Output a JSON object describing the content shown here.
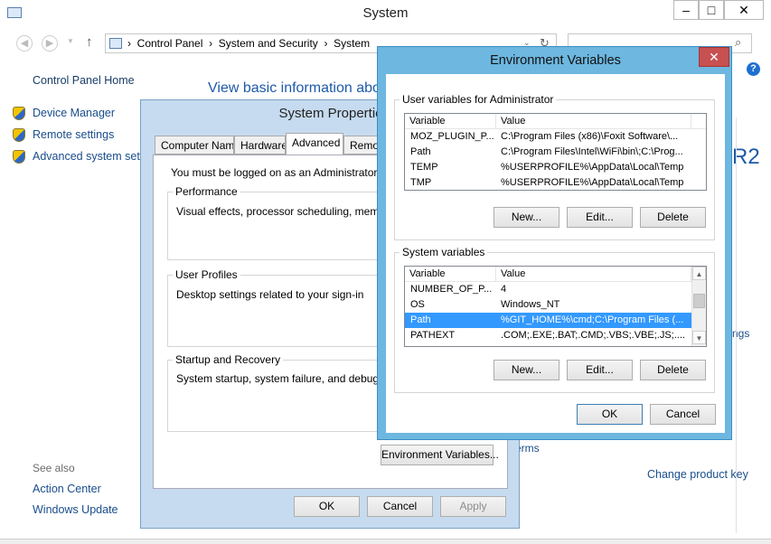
{
  "system_window": {
    "title": "System",
    "window_buttons": [
      "–",
      "□",
      "✕"
    ],
    "address": {
      "crumbs": [
        "Control Panel",
        "System and Security",
        "System"
      ],
      "separator": "›"
    },
    "left_nav": {
      "home": "Control Panel Home",
      "links": [
        "Device Manager",
        "Remote settings",
        "Advanced system setti"
      ],
      "see_also_label": "See also",
      "see_also": [
        "Action Center",
        "Windows Update"
      ]
    },
    "heading_fragment": "View basic information abo",
    "r2_fragment": "R2",
    "terms_fragment": "erms",
    "ngs_fragment": "ngs",
    "change_product_key": "Change product key",
    "help_icon": "?"
  },
  "system_properties": {
    "title": "System Propertie",
    "tabs": [
      "Computer Name",
      "Hardware",
      "Advanced",
      "Remote"
    ],
    "active_tab": "Advanced",
    "admin_notice": "You must be logged on as an Administrator to ma",
    "groups": [
      {
        "label": "Performance",
        "text": "Visual effects, processor scheduling, memory us"
      },
      {
        "label": "User Profiles",
        "text": "Desktop settings related to your sign-in"
      },
      {
        "label": "Startup and Recovery",
        "text": "System startup, system failure, and debugging in"
      }
    ],
    "env_button": "Environment Variables...",
    "buttons": {
      "ok": "OK",
      "cancel": "Cancel",
      "apply": "Apply"
    }
  },
  "env_vars": {
    "title": "Environment Variables",
    "close": "✕",
    "user_group_label": "User variables for Administrator",
    "columns": [
      "Variable",
      "Value"
    ],
    "user_vars": [
      {
        "name": "MOZ_PLUGIN_P...",
        "value": "C:\\Program Files (x86)\\Foxit Software\\..."
      },
      {
        "name": "Path",
        "value": "C:\\Program Files\\Intel\\WiFi\\bin\\;C:\\Prog..."
      },
      {
        "name": "TEMP",
        "value": "%USERPROFILE%\\AppData\\Local\\Temp"
      },
      {
        "name": "TMP",
        "value": "%USERPROFILE%\\AppData\\Local\\Temp"
      }
    ],
    "system_group_label": "System variables",
    "system_vars": [
      {
        "name": "NUMBER_OF_P...",
        "value": "4"
      },
      {
        "name": "OS",
        "value": "Windows_NT"
      },
      {
        "name": "Path",
        "value": "%GIT_HOME%\\cmd;C:\\Program Files (..."
      },
      {
        "name": "PATHEXT",
        "value": ".COM;.EXE;.BAT;.CMD;.VBS;.VBE;.JS;...."
      }
    ],
    "selected_system_row": 2,
    "user_buttons": {
      "new": "New...",
      "edit": "Edit...",
      "delete": "Delete"
    },
    "system_buttons": {
      "new": "New...",
      "edit": "Edit...",
      "delete": "Delete"
    },
    "ok": "OK",
    "cancel": "Cancel",
    "accent_selected": "#3399ff"
  }
}
